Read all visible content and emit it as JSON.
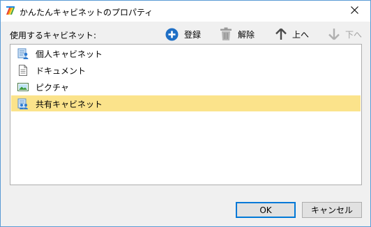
{
  "window": {
    "title": "かんたんキャビネットのプロパティ",
    "app_icon": "rainbow-app-icon",
    "close_icon": "close-icon"
  },
  "cabinets_label": "使用するキャビネット:",
  "toolbar": {
    "add_label": "登録",
    "remove_label": "解除",
    "up_label": "上へ",
    "down_label": "下へ",
    "add_icon": "plus-circle-icon",
    "remove_icon": "trash-icon",
    "up_icon": "arrow-up-icon",
    "down_icon": "arrow-down-icon"
  },
  "list": {
    "items": [
      {
        "label": "個人キャビネット",
        "icon": "personal-cabinet-icon",
        "selected": false
      },
      {
        "label": "ドキュメント",
        "icon": "document-icon",
        "selected": false
      },
      {
        "label": "ピクチャ",
        "icon": "picture-icon",
        "selected": false
      },
      {
        "label": "共有キャビネット",
        "icon": "shared-cabinet-icon",
        "selected": true
      }
    ]
  },
  "buttons": {
    "ok_label": "OK",
    "cancel_label": "キャンセル"
  },
  "colors": {
    "selection": "#fbe38b",
    "accent": "#0078d7",
    "add_icon": "#1f6fc5",
    "disabled_text": "#a0a0a0"
  }
}
